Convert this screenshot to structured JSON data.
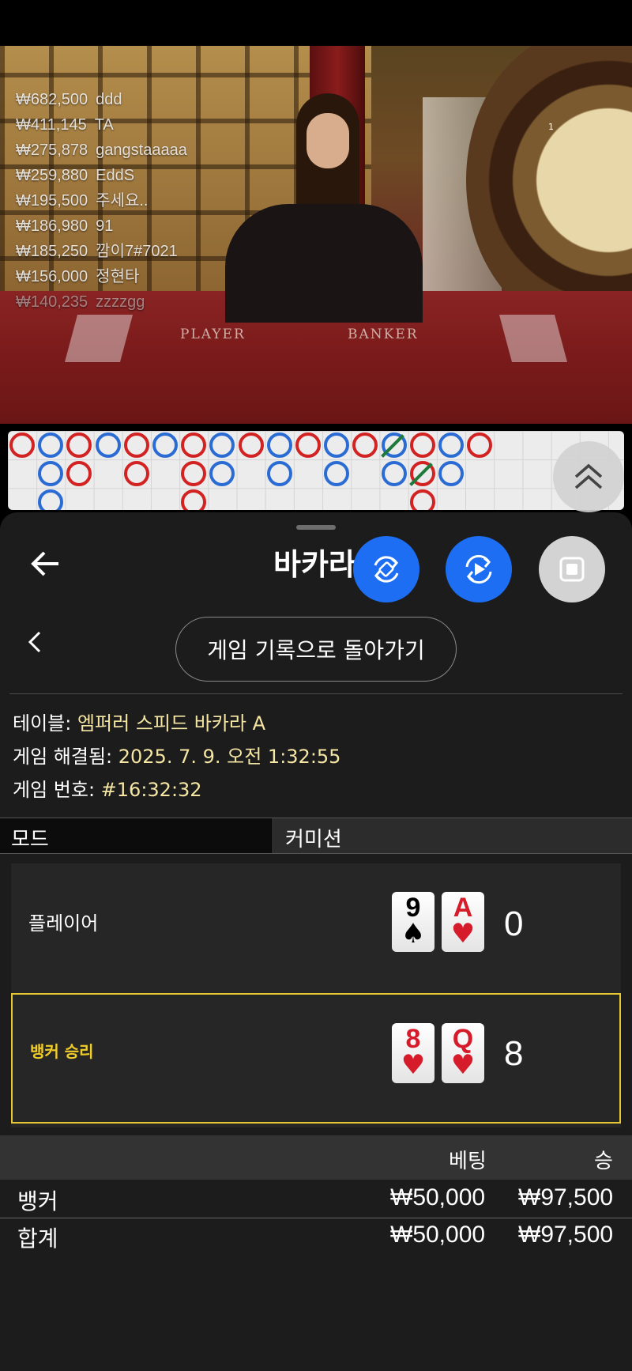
{
  "video": {
    "leaderboard": [
      {
        "amount": "₩682,500",
        "name": "ddd"
      },
      {
        "amount": "₩411,145",
        "name": "TA"
      },
      {
        "amount": "₩275,878",
        "name": "gangstaaaaa"
      },
      {
        "amount": "₩259,880",
        "name": "EddS"
      },
      {
        "amount": "₩195,500",
        "name": "주세요.."
      },
      {
        "amount": "₩186,980",
        "name": "91"
      },
      {
        "amount": "₩185,250",
        "name": "깜이7#7021"
      },
      {
        "amount": "₩156,000",
        "name": "정현타"
      },
      {
        "amount": "₩140,235",
        "name": "zzzzgg"
      }
    ],
    "table_player_label": "PLAYER",
    "table_banker_label": "BANKER",
    "camera_mark": "1"
  },
  "roadmap": {
    "colors": {
      "banker": "#d22222",
      "player": "#2a6cd4",
      "tie": "#1e7a3a"
    }
  },
  "sheet": {
    "title": "바카라",
    "history_button": "게임 기록으로 돌아가기",
    "info": {
      "table_label": "테이블: ",
      "table_value": "엠퍼러 스피드 바카라 A",
      "resolved_label": "게임 해결됨: ",
      "resolved_value": "2025. 7. 9. 오전 1:32:55",
      "number_label": "게임 번호: ",
      "number_value": "#16:32:32"
    },
    "mode_label": "모드",
    "mode_value": "커미션",
    "player": {
      "label": "플레이어",
      "cards": [
        {
          "rank": "9",
          "suit": "♠"
        },
        {
          "rank": "A",
          "suit": "♥"
        }
      ],
      "score": "0"
    },
    "banker": {
      "label": "뱅커 승리",
      "cards": [
        {
          "rank": "8",
          "suit": "♥"
        },
        {
          "rank": "Q",
          "suit": "♥"
        }
      ],
      "score": "8"
    },
    "bets": {
      "col_bet": "베팅",
      "col_win": "승",
      "rows": [
        {
          "name": "뱅커",
          "bet": "₩50,000",
          "win": "₩97,500"
        },
        {
          "name": "합계",
          "bet": "₩50,000",
          "win": "₩97,500"
        }
      ]
    },
    "accent_colors": {
      "fab_blue": "#1d6ef2",
      "winner_gold": "#f0cd2a",
      "info_value": "#f5e6a4"
    }
  }
}
